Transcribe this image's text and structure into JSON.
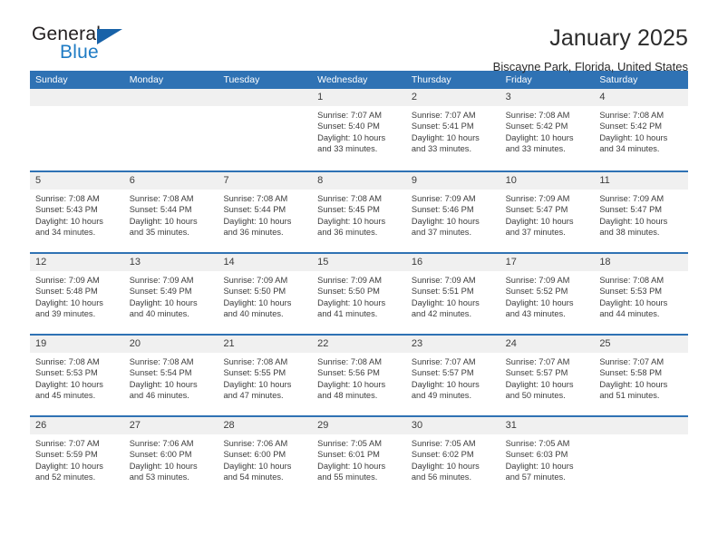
{
  "brand": {
    "name_top": "General",
    "name_bottom": "Blue",
    "triangle_color": "#1862a8",
    "blue": "#1e7bc4"
  },
  "header": {
    "title": "January 2025",
    "subtitle": "Biscayne Park, Florida, United States"
  },
  "theme": {
    "header_blue": "#2f72b4",
    "day_band_gray": "#f0f0f0",
    "text": "#3c3c3c"
  },
  "weekdays": [
    "Sunday",
    "Monday",
    "Tuesday",
    "Wednesday",
    "Thursday",
    "Friday",
    "Saturday"
  ],
  "weeks": [
    [
      {
        "day": ""
      },
      {
        "day": ""
      },
      {
        "day": ""
      },
      {
        "day": "1",
        "sunrise": "Sunrise: 7:07 AM",
        "sunset": "Sunset: 5:40 PM",
        "daylight_l1": "Daylight: 10 hours",
        "daylight_l2": "and 33 minutes."
      },
      {
        "day": "2",
        "sunrise": "Sunrise: 7:07 AM",
        "sunset": "Sunset: 5:41 PM",
        "daylight_l1": "Daylight: 10 hours",
        "daylight_l2": "and 33 minutes."
      },
      {
        "day": "3",
        "sunrise": "Sunrise: 7:08 AM",
        "sunset": "Sunset: 5:42 PM",
        "daylight_l1": "Daylight: 10 hours",
        "daylight_l2": "and 33 minutes."
      },
      {
        "day": "4",
        "sunrise": "Sunrise: 7:08 AM",
        "sunset": "Sunset: 5:42 PM",
        "daylight_l1": "Daylight: 10 hours",
        "daylight_l2": "and 34 minutes."
      }
    ],
    [
      {
        "day": "5",
        "sunrise": "Sunrise: 7:08 AM",
        "sunset": "Sunset: 5:43 PM",
        "daylight_l1": "Daylight: 10 hours",
        "daylight_l2": "and 34 minutes."
      },
      {
        "day": "6",
        "sunrise": "Sunrise: 7:08 AM",
        "sunset": "Sunset: 5:44 PM",
        "daylight_l1": "Daylight: 10 hours",
        "daylight_l2": "and 35 minutes."
      },
      {
        "day": "7",
        "sunrise": "Sunrise: 7:08 AM",
        "sunset": "Sunset: 5:44 PM",
        "daylight_l1": "Daylight: 10 hours",
        "daylight_l2": "and 36 minutes."
      },
      {
        "day": "8",
        "sunrise": "Sunrise: 7:08 AM",
        "sunset": "Sunset: 5:45 PM",
        "daylight_l1": "Daylight: 10 hours",
        "daylight_l2": "and 36 minutes."
      },
      {
        "day": "9",
        "sunrise": "Sunrise: 7:09 AM",
        "sunset": "Sunset: 5:46 PM",
        "daylight_l1": "Daylight: 10 hours",
        "daylight_l2": "and 37 minutes."
      },
      {
        "day": "10",
        "sunrise": "Sunrise: 7:09 AM",
        "sunset": "Sunset: 5:47 PM",
        "daylight_l1": "Daylight: 10 hours",
        "daylight_l2": "and 37 minutes."
      },
      {
        "day": "11",
        "sunrise": "Sunrise: 7:09 AM",
        "sunset": "Sunset: 5:47 PM",
        "daylight_l1": "Daylight: 10 hours",
        "daylight_l2": "and 38 minutes."
      }
    ],
    [
      {
        "day": "12",
        "sunrise": "Sunrise: 7:09 AM",
        "sunset": "Sunset: 5:48 PM",
        "daylight_l1": "Daylight: 10 hours",
        "daylight_l2": "and 39 minutes."
      },
      {
        "day": "13",
        "sunrise": "Sunrise: 7:09 AM",
        "sunset": "Sunset: 5:49 PM",
        "daylight_l1": "Daylight: 10 hours",
        "daylight_l2": "and 40 minutes."
      },
      {
        "day": "14",
        "sunrise": "Sunrise: 7:09 AM",
        "sunset": "Sunset: 5:50 PM",
        "daylight_l1": "Daylight: 10 hours",
        "daylight_l2": "and 40 minutes."
      },
      {
        "day": "15",
        "sunrise": "Sunrise: 7:09 AM",
        "sunset": "Sunset: 5:50 PM",
        "daylight_l1": "Daylight: 10 hours",
        "daylight_l2": "and 41 minutes."
      },
      {
        "day": "16",
        "sunrise": "Sunrise: 7:09 AM",
        "sunset": "Sunset: 5:51 PM",
        "daylight_l1": "Daylight: 10 hours",
        "daylight_l2": "and 42 minutes."
      },
      {
        "day": "17",
        "sunrise": "Sunrise: 7:09 AM",
        "sunset": "Sunset: 5:52 PM",
        "daylight_l1": "Daylight: 10 hours",
        "daylight_l2": "and 43 minutes."
      },
      {
        "day": "18",
        "sunrise": "Sunrise: 7:08 AM",
        "sunset": "Sunset: 5:53 PM",
        "daylight_l1": "Daylight: 10 hours",
        "daylight_l2": "and 44 minutes."
      }
    ],
    [
      {
        "day": "19",
        "sunrise": "Sunrise: 7:08 AM",
        "sunset": "Sunset: 5:53 PM",
        "daylight_l1": "Daylight: 10 hours",
        "daylight_l2": "and 45 minutes."
      },
      {
        "day": "20",
        "sunrise": "Sunrise: 7:08 AM",
        "sunset": "Sunset: 5:54 PM",
        "daylight_l1": "Daylight: 10 hours",
        "daylight_l2": "and 46 minutes."
      },
      {
        "day": "21",
        "sunrise": "Sunrise: 7:08 AM",
        "sunset": "Sunset: 5:55 PM",
        "daylight_l1": "Daylight: 10 hours",
        "daylight_l2": "and 47 minutes."
      },
      {
        "day": "22",
        "sunrise": "Sunrise: 7:08 AM",
        "sunset": "Sunset: 5:56 PM",
        "daylight_l1": "Daylight: 10 hours",
        "daylight_l2": "and 48 minutes."
      },
      {
        "day": "23",
        "sunrise": "Sunrise: 7:07 AM",
        "sunset": "Sunset: 5:57 PM",
        "daylight_l1": "Daylight: 10 hours",
        "daylight_l2": "and 49 minutes."
      },
      {
        "day": "24",
        "sunrise": "Sunrise: 7:07 AM",
        "sunset": "Sunset: 5:57 PM",
        "daylight_l1": "Daylight: 10 hours",
        "daylight_l2": "and 50 minutes."
      },
      {
        "day": "25",
        "sunrise": "Sunrise: 7:07 AM",
        "sunset": "Sunset: 5:58 PM",
        "daylight_l1": "Daylight: 10 hours",
        "daylight_l2": "and 51 minutes."
      }
    ],
    [
      {
        "day": "26",
        "sunrise": "Sunrise: 7:07 AM",
        "sunset": "Sunset: 5:59 PM",
        "daylight_l1": "Daylight: 10 hours",
        "daylight_l2": "and 52 minutes."
      },
      {
        "day": "27",
        "sunrise": "Sunrise: 7:06 AM",
        "sunset": "Sunset: 6:00 PM",
        "daylight_l1": "Daylight: 10 hours",
        "daylight_l2": "and 53 minutes."
      },
      {
        "day": "28",
        "sunrise": "Sunrise: 7:06 AM",
        "sunset": "Sunset: 6:00 PM",
        "daylight_l1": "Daylight: 10 hours",
        "daylight_l2": "and 54 minutes."
      },
      {
        "day": "29",
        "sunrise": "Sunrise: 7:05 AM",
        "sunset": "Sunset: 6:01 PM",
        "daylight_l1": "Daylight: 10 hours",
        "daylight_l2": "and 55 minutes."
      },
      {
        "day": "30",
        "sunrise": "Sunrise: 7:05 AM",
        "sunset": "Sunset: 6:02 PM",
        "daylight_l1": "Daylight: 10 hours",
        "daylight_l2": "and 56 minutes."
      },
      {
        "day": "31",
        "sunrise": "Sunrise: 7:05 AM",
        "sunset": "Sunset: 6:03 PM",
        "daylight_l1": "Daylight: 10 hours",
        "daylight_l2": "and 57 minutes."
      },
      {
        "day": ""
      }
    ]
  ]
}
